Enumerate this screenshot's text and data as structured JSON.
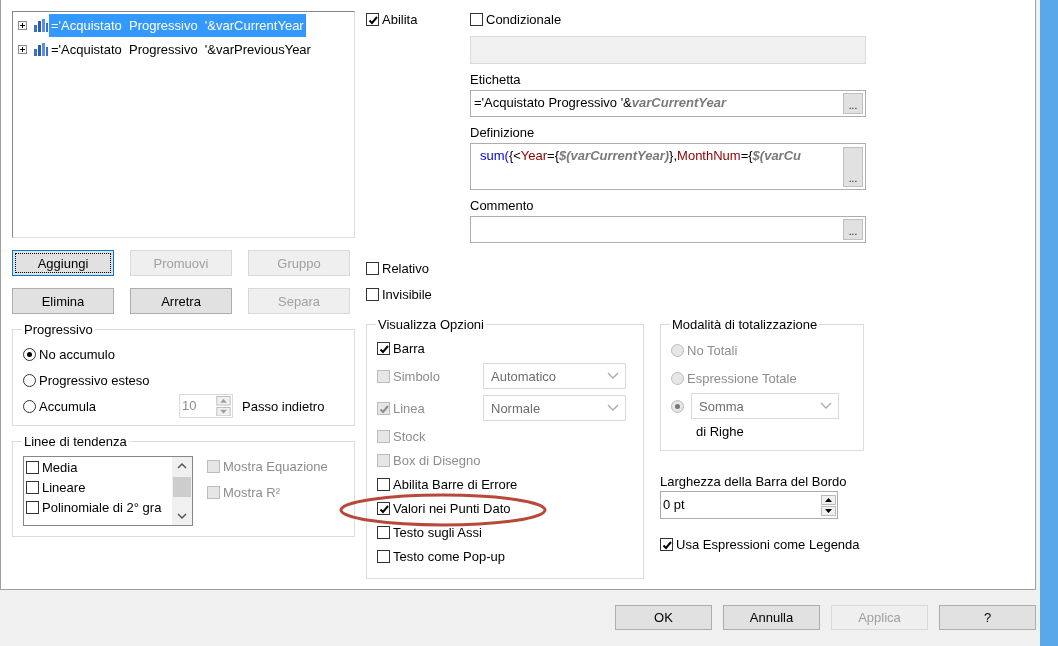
{
  "expressions_tree": {
    "items": [
      {
        "label": "='Acquistato  Progressivo  '&varCurrentYear",
        "selected": true,
        "expanded": false
      },
      {
        "label": "='Acquistato  Progressivo  '&varPreviousYear",
        "selected": false,
        "expanded": false
      }
    ]
  },
  "expression_buttons": [
    {
      "label": "Aggiungi",
      "disabled": false,
      "focused": true
    },
    {
      "label": "Promuovi",
      "disabled": true,
      "focused": false
    },
    {
      "label": "Gruppo",
      "disabled": true,
      "focused": false
    },
    {
      "label": "Elimina",
      "disabled": false,
      "focused": false
    },
    {
      "label": "Arretra",
      "disabled": false,
      "focused": false
    },
    {
      "label": "Separa",
      "disabled": true,
      "focused": false
    }
  ],
  "progressive": {
    "title": "Progressivo",
    "options": [
      {
        "label": "No accumulo",
        "selected": true
      },
      {
        "label": "Progressivo esteso",
        "selected": false
      },
      {
        "label": "Accumula",
        "selected": false
      }
    ],
    "steps_back": {
      "value": "10",
      "disabled": true,
      "label": "Passo indietro"
    }
  },
  "trendlines": {
    "title": "Linee di tendenza",
    "items": [
      {
        "label": "Media",
        "checked": false
      },
      {
        "label": "Lineare",
        "checked": false
      },
      {
        "label": "Polinomiale di 2° gra",
        "checked": false
      }
    ],
    "options": [
      {
        "label": "Mostra Equazione",
        "checked": false,
        "disabled": true
      },
      {
        "label": "Mostra R²",
        "checked": false,
        "disabled": true
      }
    ]
  },
  "enable": {
    "label": "Abilita",
    "checked": true
  },
  "conditional": {
    "label": "Condizionale",
    "checked": false,
    "field_disabled": true
  },
  "label_field": {
    "title": "Etichetta",
    "browse_button": "...",
    "segments": [
      {
        "kind": "plain",
        "text": "='Acquistato Progressivo '&"
      },
      {
        "kind": "variable",
        "text": "varCurrentYear"
      }
    ]
  },
  "definition_field": {
    "title": "Definizione",
    "browse_button": "...",
    "segments": [
      {
        "kind": "function",
        "text": "sum("
      },
      {
        "kind": "plain",
        "text": "{<"
      },
      {
        "kind": "field",
        "text": "Year"
      },
      {
        "kind": "plain",
        "text": "={"
      },
      {
        "kind": "variable",
        "text": "$(varCurrentYear)"
      },
      {
        "kind": "plain",
        "text": "},"
      },
      {
        "kind": "field",
        "text": "MonthNum"
      },
      {
        "kind": "plain",
        "text": "={"
      },
      {
        "kind": "variable",
        "text": "$(varCu"
      }
    ]
  },
  "comment_field": {
    "title": "Commento",
    "browse_button": "..."
  },
  "flags": [
    {
      "label": "Relativo",
      "checked": false
    },
    {
      "label": "Invisibile",
      "checked": false
    }
  ],
  "display_options": {
    "title": "Visualizza Opzioni",
    "items": [
      {
        "kind": "check",
        "label": "Barra",
        "checked": true,
        "disabled": false
      },
      {
        "kind": "check-select",
        "label": "Simbolo",
        "checked": false,
        "disabled": true,
        "select": "Automatico"
      },
      {
        "kind": "check-select",
        "label": "Linea",
        "checked": true,
        "disabled": true,
        "select": "Normale"
      },
      {
        "kind": "check",
        "label": "Stock",
        "checked": false,
        "disabled": true
      },
      {
        "kind": "check",
        "label": "Box di Disegno",
        "checked": false,
        "disabled": true
      },
      {
        "kind": "check",
        "label": "Abilita Barre di Errore",
        "checked": false,
        "disabled": false
      },
      {
        "kind": "check",
        "label": "Valori nei Punti Dato",
        "checked": true,
        "disabled": false
      },
      {
        "kind": "check",
        "label": "Testo sugli Assi",
        "checked": false,
        "disabled": false
      },
      {
        "kind": "check",
        "label": "Testo come Pop-up",
        "checked": false,
        "disabled": false
      }
    ]
  },
  "annotation": {
    "kind": "ellipse"
  },
  "total_mode": {
    "title": "Modalità di totalizzazione",
    "disabled": true,
    "options": [
      {
        "kind": "radio",
        "label": "No Totali",
        "selected": false
      },
      {
        "kind": "radio",
        "label": "Espressione Totale",
        "selected": false
      },
      {
        "kind": "radio-select",
        "select": "Somma",
        "note": "di Righe",
        "selected": true
      }
    ]
  },
  "border_width": {
    "label": "Larghezza della Barra del Bordo",
    "value": "0 pt"
  },
  "legend_option": {
    "label": "Usa Espressioni come Legenda",
    "checked": true
  },
  "footer_buttons": [
    {
      "label": "OK",
      "disabled": false
    },
    {
      "label": "Annulla",
      "disabled": false
    },
    {
      "label": "Applica",
      "disabled": true
    },
    {
      "label": "?",
      "disabled": false
    }
  ]
}
